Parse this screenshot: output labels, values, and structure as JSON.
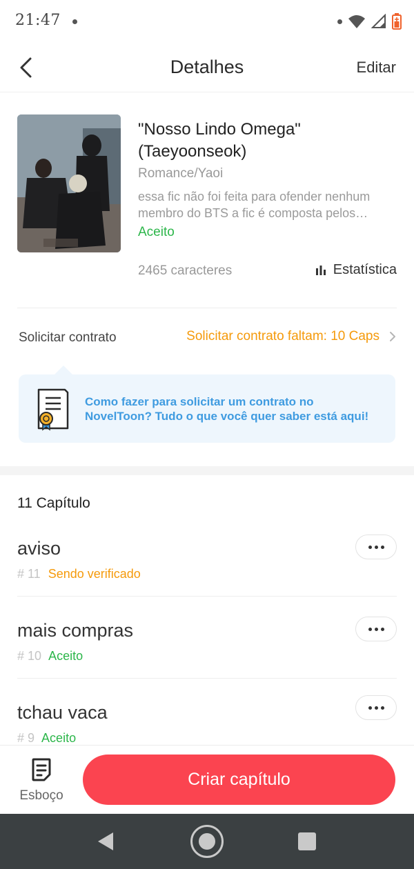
{
  "status_bar": {
    "time": "21:47"
  },
  "header": {
    "title": "Detalhes",
    "edit_label": "Editar"
  },
  "book": {
    "title": "\"Nosso Lindo Omega\" (Taeyoonseok)",
    "genre": "Romance/Yaoi",
    "description": "essa fic não foi feita para ofender nenhum membro do BTS a fic é composta pelos membros do BTS",
    "status": "Aceito",
    "characters": "2465 caracteres",
    "stats_label": "Estatística"
  },
  "contract": {
    "label": "Solicitar contrato",
    "link_text": "Solicitar contrato faltam: 10 Caps",
    "info_text": "Como fazer para solicitar um contrato no NovelToon? Tudo o que você quer saber está aqui!"
  },
  "chapters": {
    "count_label": "11 Capítulo",
    "items": [
      {
        "title": "aviso",
        "number": "# 11",
        "status": "Sendo verificado"
      },
      {
        "title": "mais compras",
        "number": "# 10",
        "status": "Aceito"
      },
      {
        "title": "tchau vaca",
        "number": "# 9",
        "status": "Aceito"
      }
    ]
  },
  "bottom_bar": {
    "draft_label": "Esboço",
    "create_label": "Criar capítulo"
  },
  "colors": {
    "accent_red": "#fb4450",
    "status_green": "#2cb64a",
    "status_orange": "#f59a0b",
    "info_blue": "#3f9be0",
    "nav_bar": "#3b4042"
  },
  "icons": [
    "back-icon",
    "bar-chart-icon",
    "chevron-right-icon",
    "certificate-icon",
    "more-icon",
    "draft-icon",
    "wifi-icon",
    "signal-icon",
    "battery-icon"
  ]
}
